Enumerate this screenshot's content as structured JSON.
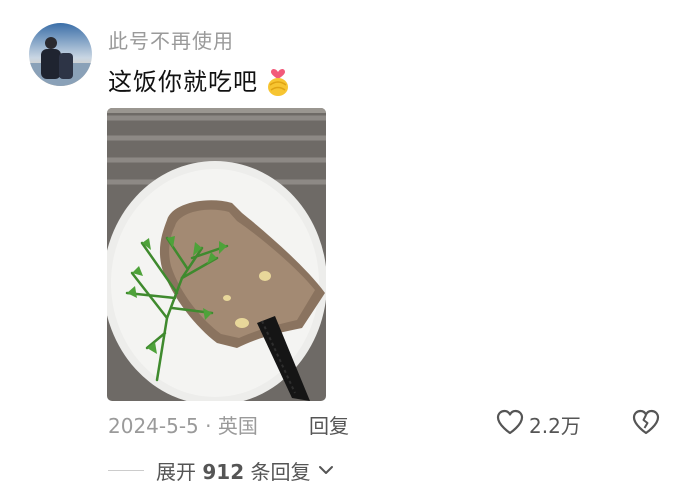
{
  "comment": {
    "username": "此号不再使用",
    "text": "这饭你就吃吧",
    "emoji_icon": "heart-hands-icon",
    "photo_subject": "toast-with-arugula-on-plate",
    "date": "2024-5-5",
    "separator": "·",
    "location": "英国",
    "reply_label": "回复",
    "likes": "2.2万"
  },
  "replies": {
    "expand_prefix": "展开",
    "count": "912",
    "expand_suffix": "条回复"
  },
  "colors": {
    "secondary_text": "#9a9a9a",
    "primary_text": "#111111",
    "action_text": "#555555"
  }
}
